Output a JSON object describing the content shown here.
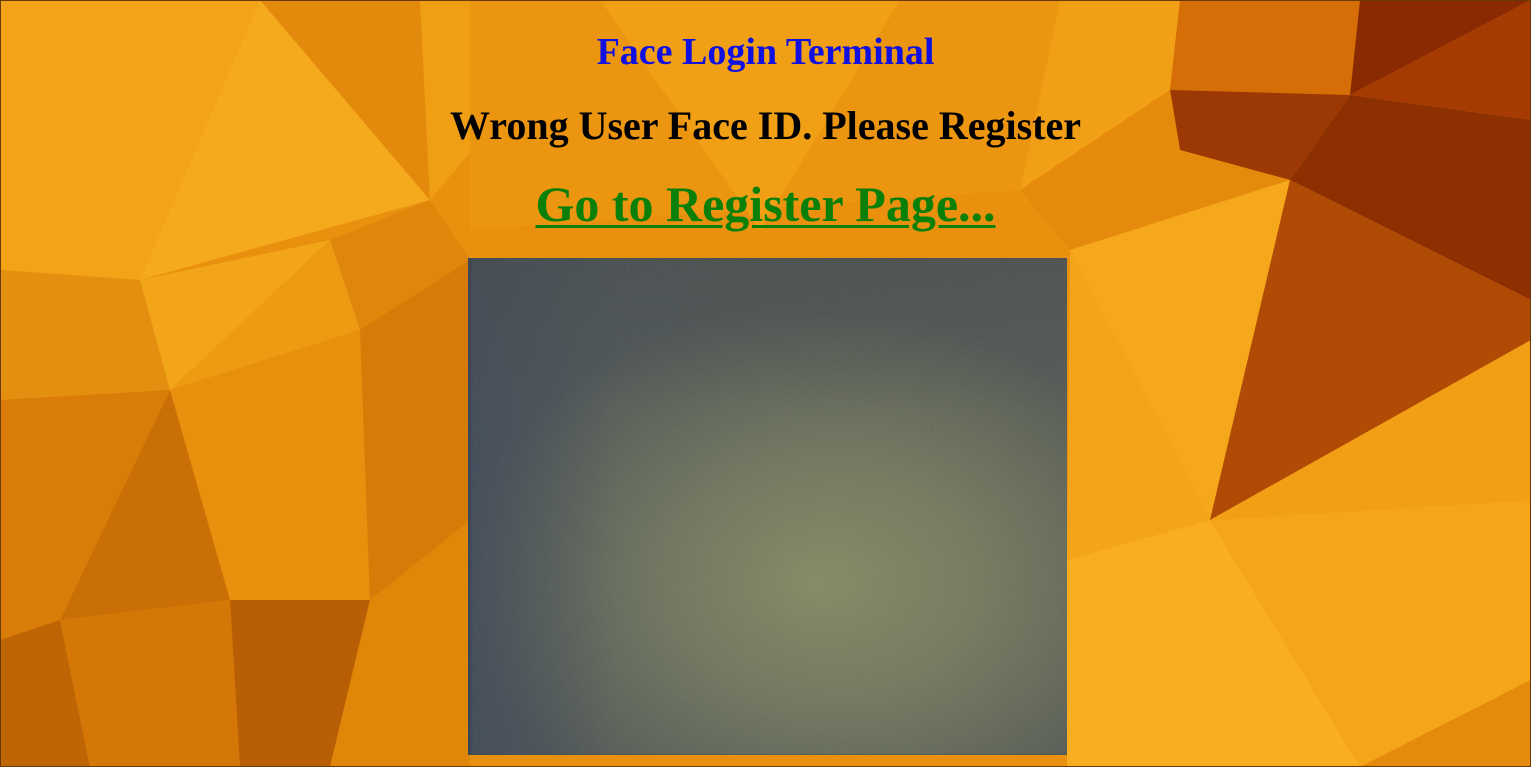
{
  "page": {
    "title": "Face Login Terminal",
    "message": "Wrong User Face ID. Please Register",
    "register_link_label": "Go to Register Page..."
  },
  "colors": {
    "title": "#1010e0",
    "message": "#000000",
    "link": "#0a800a",
    "background_accent": "#e8890a"
  },
  "camera": {
    "icon": "webcam-feed"
  }
}
